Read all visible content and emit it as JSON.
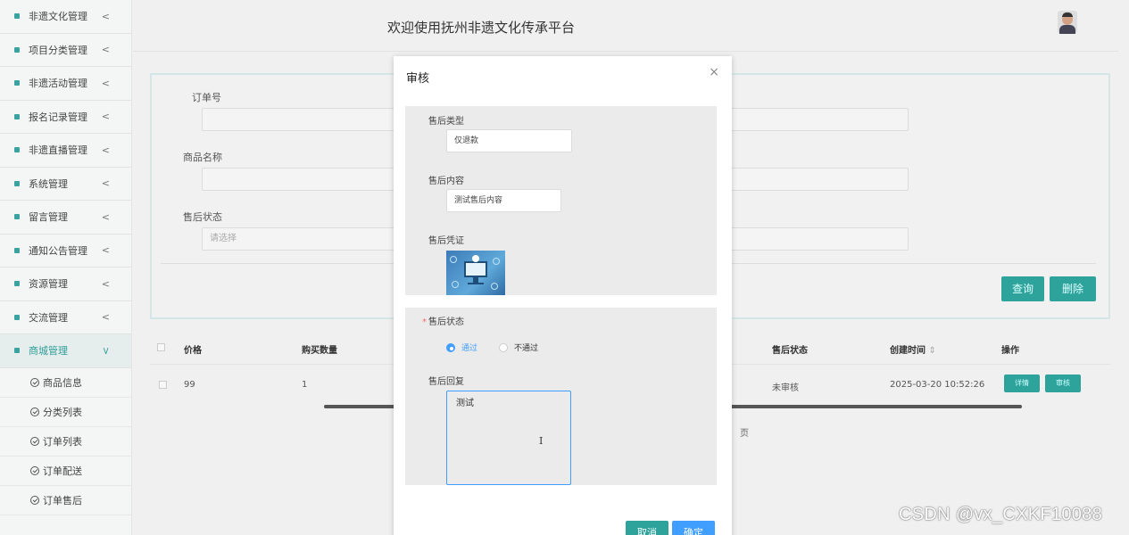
{
  "header": {
    "title": "欢迎使用抚州非遗文化传承平台"
  },
  "sidebar": {
    "items": [
      {
        "label": "非遗文化管理",
        "icon": "<"
      },
      {
        "label": "项目分类管理",
        "icon": "<"
      },
      {
        "label": "非遗活动管理",
        "icon": "<"
      },
      {
        "label": "报名记录管理",
        "icon": "<"
      },
      {
        "label": "非遗直播管理",
        "icon": "<"
      },
      {
        "label": "系统管理",
        "icon": "<"
      },
      {
        "label": "留言管理",
        "icon": "<"
      },
      {
        "label": "通知公告管理",
        "icon": "<"
      },
      {
        "label": "资源管理",
        "icon": "<"
      },
      {
        "label": "交流管理",
        "icon": "<"
      },
      {
        "label": "商城管理",
        "icon": "<"
      }
    ],
    "sub_items": [
      {
        "label": "商品信息"
      },
      {
        "label": "分类列表"
      },
      {
        "label": "订单列表"
      },
      {
        "label": "订单配送"
      },
      {
        "label": "订单售后"
      }
    ]
  },
  "search": {
    "order_no_label": "订单号",
    "product_name_label": "商品名称",
    "after_sale_status_label": "售后状态",
    "status_placeholder": "请选择",
    "query_button": "查询",
    "delete_button": "删除"
  },
  "table": {
    "headers": {
      "price": "价格",
      "quantity": "购买数量",
      "status": "售后状态",
      "created": "创建时间",
      "created_sort": "⇕",
      "actions": "操作"
    },
    "rows": [
      {
        "price": "99",
        "quantity": "1",
        "status": "未审核",
        "created": "2025-03-20 10:52:26",
        "detail_button": "详情",
        "review_button": "审核"
      }
    ],
    "page_hint": "页"
  },
  "dialog": {
    "title": "审核",
    "close": "×",
    "after_sale_type_label": "售后类型",
    "after_sale_type_value": "仅退款",
    "after_sale_content_label": "售后内容",
    "after_sale_content_value": "测试售后内容",
    "proof_label": "售后凭证",
    "status_required_mark": "*",
    "status_label": "售后状态",
    "status_options": [
      {
        "label": "通过",
        "checked": true
      },
      {
        "label": "不通过",
        "checked": false
      }
    ],
    "reply_label": "售后回复",
    "reply_value": "测试",
    "cancel_button": "取消",
    "confirm_button": "确定"
  },
  "watermark": "CSDN @vx_CXKF10088",
  "colors": {
    "accent": "#2ea39c",
    "primary": "#409eff",
    "required": "#f56c6c"
  }
}
